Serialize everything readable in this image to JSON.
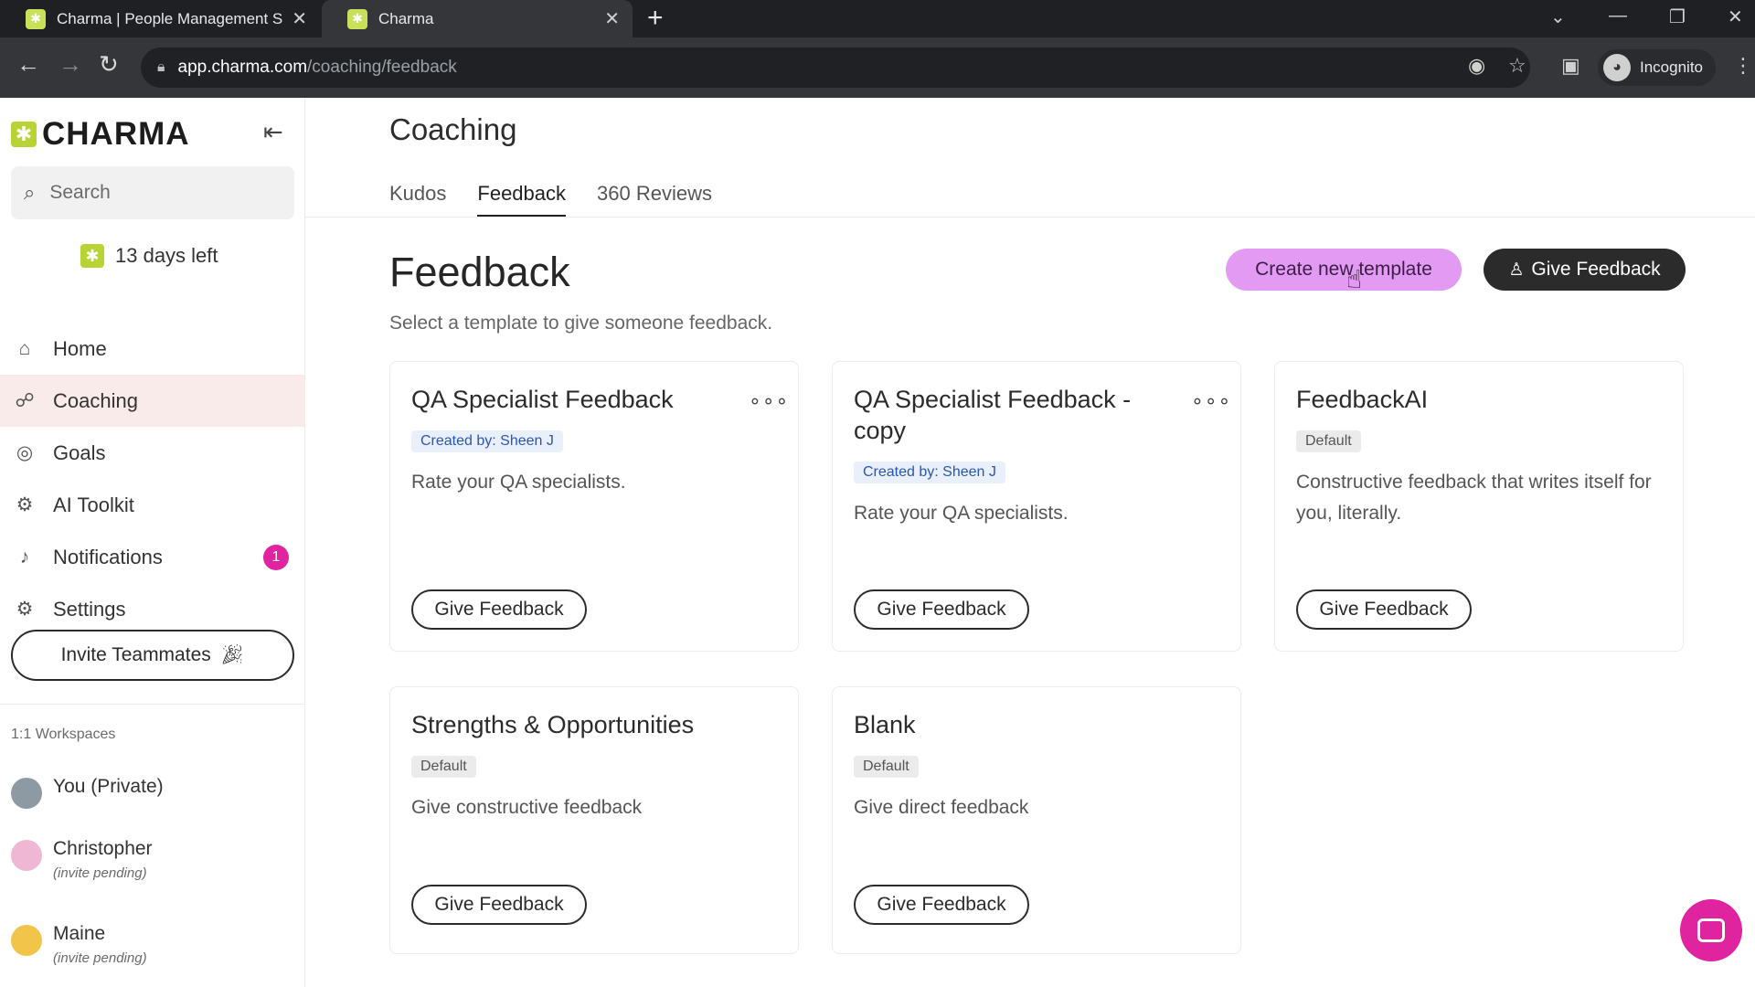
{
  "browser": {
    "tabs": [
      {
        "title": "Charma | People Management S",
        "active": false
      },
      {
        "title": "Charma",
        "active": true
      }
    ],
    "url_host": "app.charma.com",
    "url_path": "/coaching/feedback",
    "profile_label": "Incognito"
  },
  "sidebar": {
    "logo_text": "CHARMA",
    "search_placeholder": "Search",
    "trial_text": "13 days left",
    "nav": [
      {
        "label": "Home",
        "icon": "home-icon"
      },
      {
        "label": "Coaching",
        "icon": "coaching-icon",
        "active": true
      },
      {
        "label": "Goals",
        "icon": "target-icon"
      },
      {
        "label": "AI Toolkit",
        "icon": "robot-icon"
      },
      {
        "label": "Notifications",
        "icon": "bell-icon",
        "badge": "1"
      },
      {
        "label": "Settings",
        "icon": "gear-icon"
      }
    ],
    "invite_label": "Invite Teammates",
    "workspaces_label": "1:1 Workspaces",
    "workspaces": [
      {
        "name": "You (Private)",
        "status": ""
      },
      {
        "name": "Christopher",
        "status": "(invite pending)"
      },
      {
        "name": "Maine",
        "status": "(invite pending)"
      }
    ]
  },
  "main": {
    "page_title": "Coaching",
    "tabs": [
      {
        "label": "Kudos",
        "active": false
      },
      {
        "label": "Feedback",
        "active": true
      },
      {
        "label": "360 Reviews",
        "active": false
      }
    ],
    "heading": "Feedback",
    "subtitle": "Select a template to give someone feedback.",
    "create_template_label": "Create new template",
    "give_feedback_label": "Give Feedback",
    "cards": [
      {
        "title": "QA Specialist Feedback",
        "badge": "Created by: Sheen J",
        "badge_type": "creator",
        "description": "Rate your QA specialists.",
        "button": "Give Feedback",
        "has_menu": true
      },
      {
        "title": "QA Specialist Feedback - copy",
        "badge": "Created by: Sheen J",
        "badge_type": "creator",
        "description": "Rate your QA specialists.",
        "button": "Give Feedback",
        "has_menu": true
      },
      {
        "title": "FeedbackAI",
        "badge": "Default",
        "badge_type": "default",
        "description": "Constructive feedback that writes itself for you, literally.",
        "button": "Give Feedback",
        "has_menu": false
      },
      {
        "title": "Strengths & Opportunities",
        "badge": "Default",
        "badge_type": "default",
        "description": "Give constructive feedback",
        "button": "Give Feedback",
        "has_menu": false
      },
      {
        "title": "Blank",
        "badge": "Default",
        "badge_type": "default",
        "description": "Give direct feedback",
        "button": "Give Feedback",
        "has_menu": false
      }
    ]
  },
  "colors": {
    "accent_pink": "#e0239e",
    "create_button": "#e29af2",
    "brand_green": "#b7d334",
    "active_nav": "#f8ebe9"
  }
}
